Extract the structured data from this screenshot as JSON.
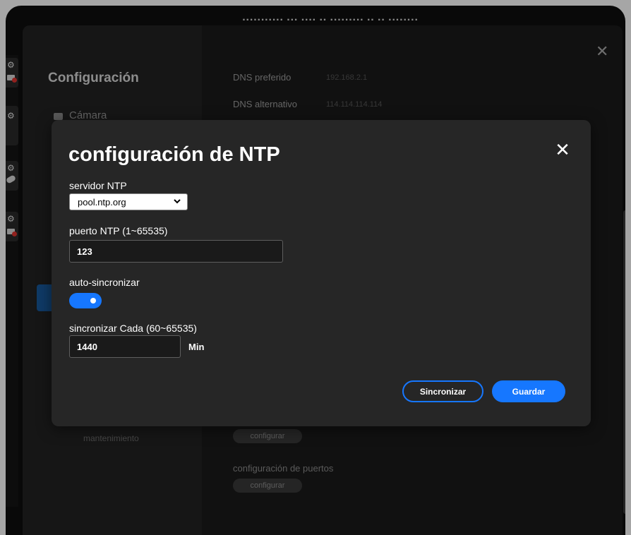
{
  "background": {
    "settings": {
      "title": "Configuración",
      "sidebar_items": [
        "Cámara",
        "mantenimiento"
      ],
      "dns": [
        {
          "label": "DNS preferido",
          "value": "192.168.2.1"
        },
        {
          "label": "DNS alternativo",
          "value": "114.114.114.114"
        }
      ],
      "ports_section": "configuración de puertos",
      "configure_label": "configurar"
    }
  },
  "modal": {
    "title": "configuración de NTP",
    "ntp_server": {
      "label": "servidor  NTP",
      "value": "pool.ntp.org"
    },
    "ntp_port": {
      "label": "puerto NTP (1~65535)",
      "value": "123"
    },
    "auto_sync": {
      "label": "auto-sincronizar",
      "enabled": true
    },
    "sync_interval": {
      "label": "sincronizar Cada (60~65535)",
      "value": "1440",
      "unit": "Min"
    },
    "buttons": {
      "sync": "Sincronizar",
      "save": "Guardar"
    }
  },
  "colors": {
    "accent": "#1677ff",
    "modal_bg": "#262626",
    "page_bg": "#1b1b1b"
  }
}
